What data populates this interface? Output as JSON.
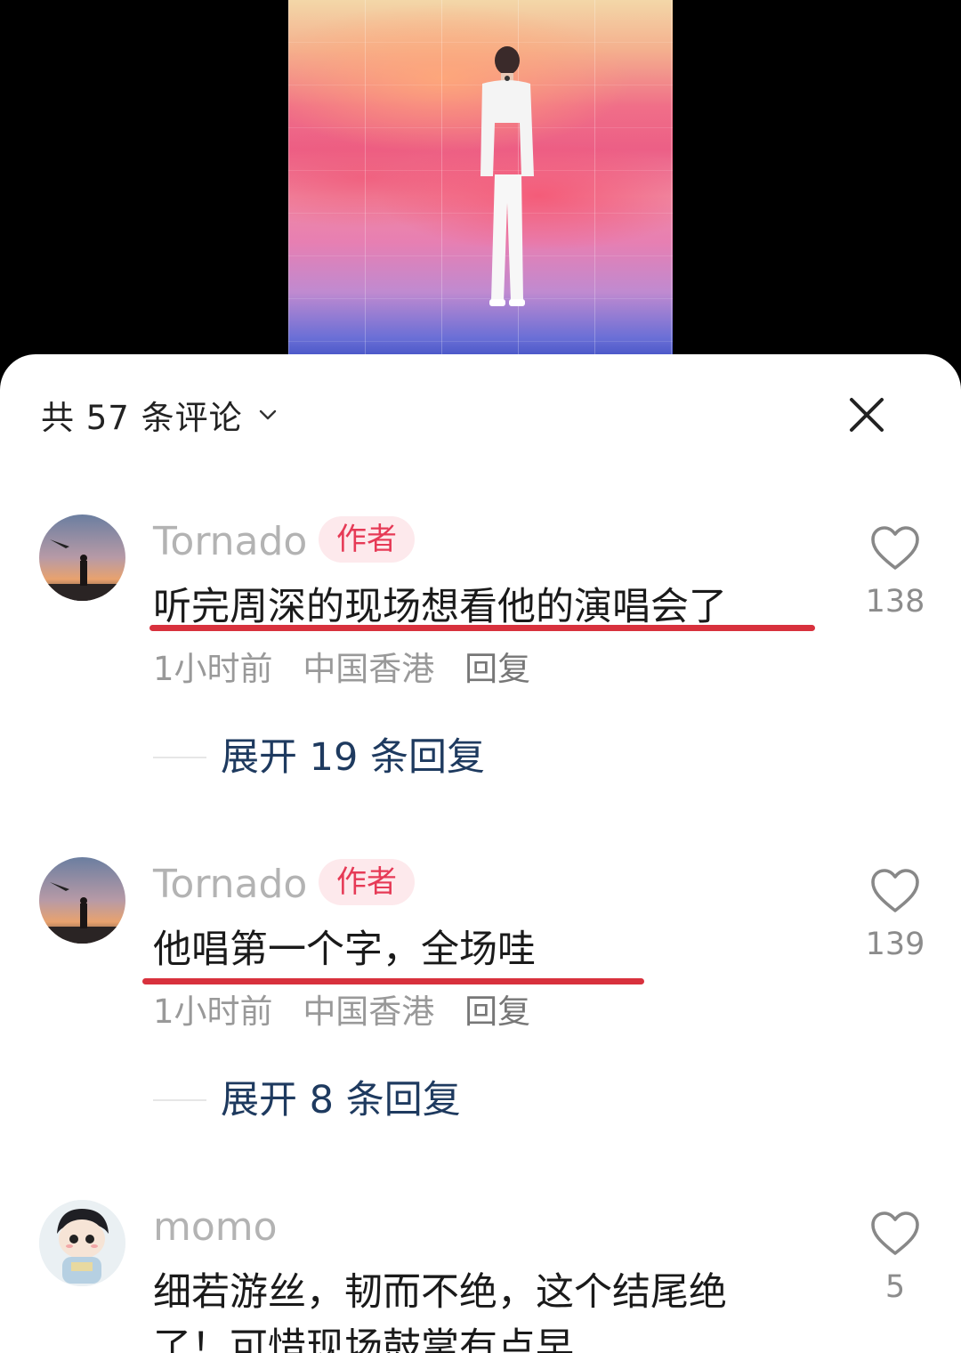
{
  "header": {
    "comment_count_title": "共 57 条评论"
  },
  "comments": [
    {
      "username": "Tornado",
      "badge": "作者",
      "text": "听完周深的现场想看他的演唱会了",
      "time": "1小时前",
      "location": "中国香港",
      "reply_label": "回复",
      "likes": "138",
      "expand_label": "展开 19 条回复"
    },
    {
      "username": "Tornado",
      "badge": "作者",
      "text": "他唱第一个字，全场哇",
      "time": "1小时前",
      "location": "中国香港",
      "reply_label": "回复",
      "likes": "139",
      "expand_label": "展开 8 条回复"
    },
    {
      "username": "momo",
      "text_line1": "细若游丝，韧而不绝，这个结尾绝",
      "text_line2": "了！可惜现场鼓掌有点早",
      "likes": "5"
    }
  ],
  "colors": {
    "underline": "#d8313d",
    "badge_text": "#e63a56",
    "badge_bg": "#fde9ec",
    "expand_text": "#1e3a5f"
  },
  "icons": [
    "chevron-down-icon",
    "close-icon",
    "heart-icon"
  ]
}
